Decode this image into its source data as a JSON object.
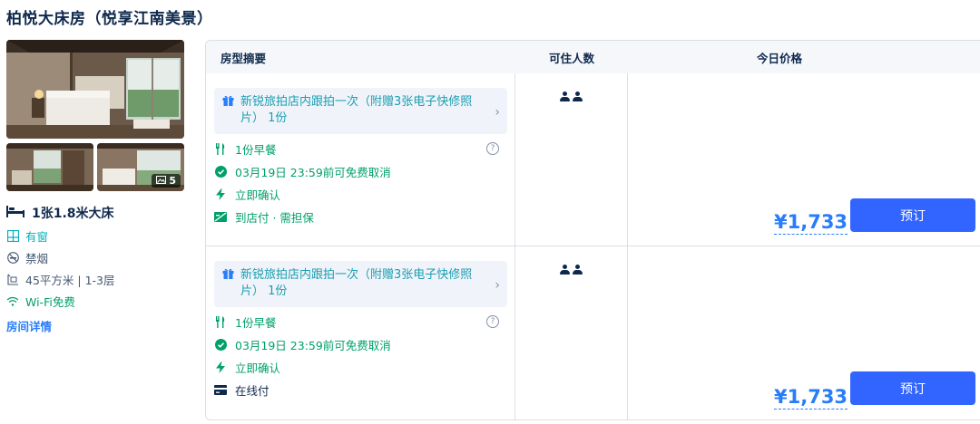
{
  "room": {
    "title": "柏悦大床房（悦享江南美景）",
    "photo_count": "5",
    "bed": "1张1.8米大床",
    "features": [
      {
        "icon": "window-icon",
        "label": "有窗"
      },
      {
        "icon": "no-smoking-icon",
        "label": "禁烟"
      },
      {
        "icon": "area-icon",
        "label": "45平方米 | 1-3层"
      },
      {
        "icon": "wifi-icon",
        "label": "Wi-Fi免费"
      }
    ],
    "details_link": "房间详情"
  },
  "table": {
    "headers": {
      "summary": "房型摘要",
      "occupancy": "可住人数",
      "price": "今日价格"
    },
    "rows": [
      {
        "gift": "新锐旅拍店内跟拍一次（附赠3张电子快修照片）1份",
        "gift_line1": "新锐旅拍店内跟拍一次（附赠3张电子快修照",
        "gift_line2": "片） 1份",
        "breakfast": "1份早餐",
        "cancel": "03月19日 23:59前可免费取消",
        "confirm": "立即确认",
        "payment": "到店付 · 需担保",
        "price": "¥1,733",
        "book": "预订"
      },
      {
        "gift": "新锐旅拍店内跟拍一次（附赠3张电子快修照片）1份",
        "gift_line1": "新锐旅拍店内跟拍一次（附赠3张电子快修照",
        "gift_line2": "片） 1份",
        "breakfast": "1份早餐",
        "cancel": "03月19日 23:59前可免费取消",
        "confirm": "立即确认",
        "payment": "在线付",
        "price": "¥1,733",
        "book": "预订"
      }
    ]
  },
  "colors": {
    "accent": "#287dfa",
    "button": "#3264ff",
    "green": "#00a06b",
    "teal": "#06aebd",
    "text": "#0f294d"
  }
}
